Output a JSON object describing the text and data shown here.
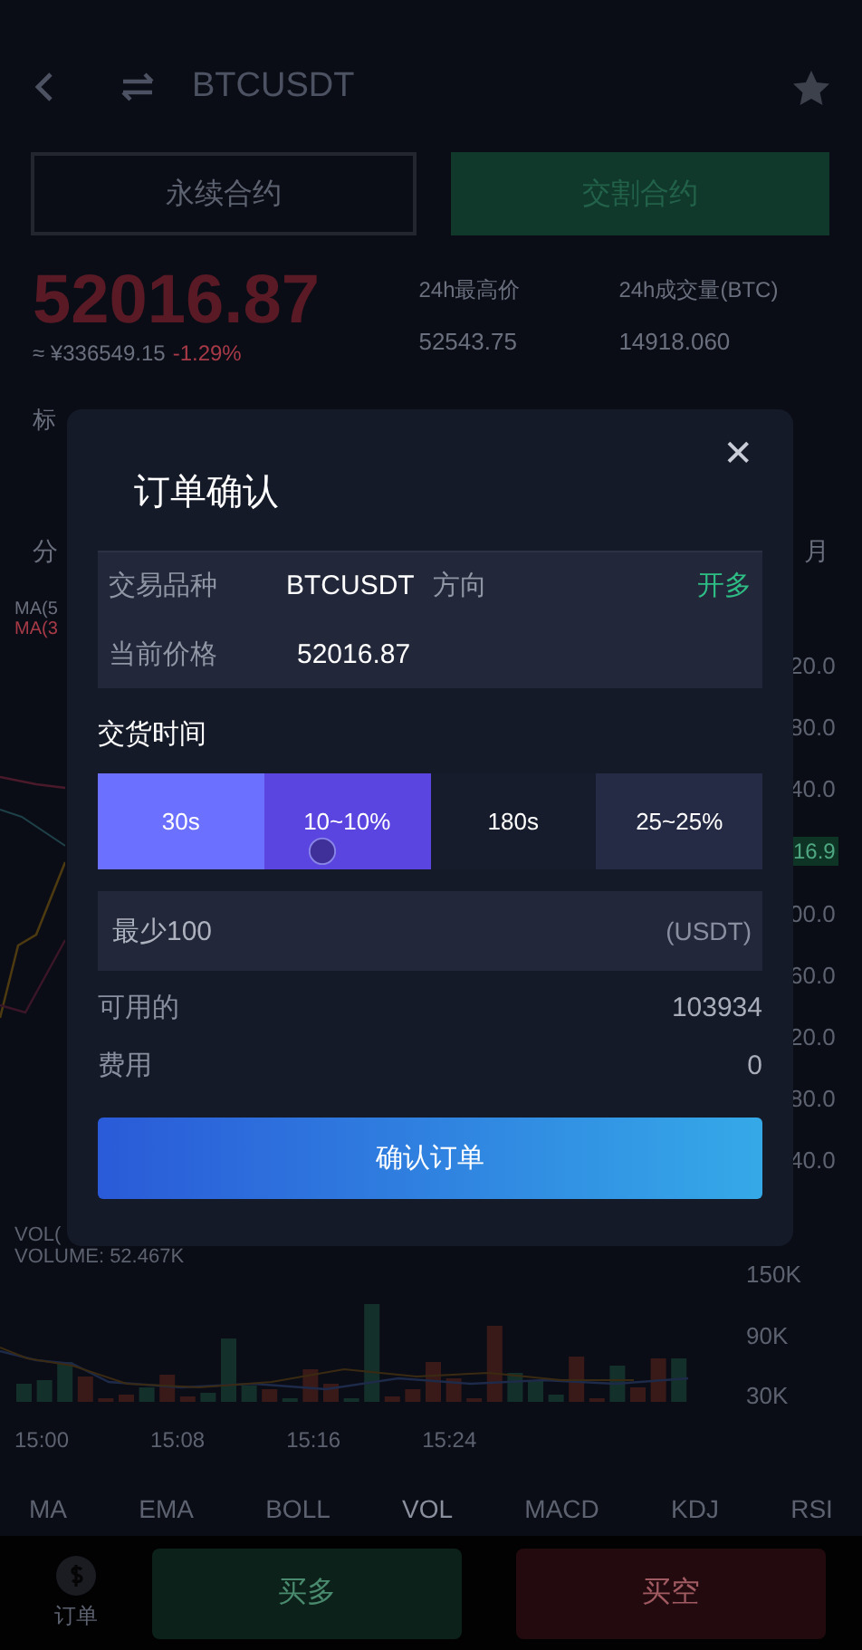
{
  "header": {
    "title": "BTCUSDT"
  },
  "contract_tabs": [
    {
      "label": "永续合约",
      "selected": false
    },
    {
      "label": "交割合约",
      "selected": true
    }
  ],
  "ticker": {
    "price": "52016.87",
    "cny": "≈ ¥336549.15",
    "change": "-1.29%",
    "stats": [
      {
        "label": "24h最高价",
        "value": "52543.75"
      },
      {
        "label": "24h成交量(BTC)",
        "value": "14918.060"
      }
    ]
  },
  "mark_label": "标",
  "timeframes": [
    "分",
    "月"
  ],
  "price_chart": {
    "legend": [
      "MA(5",
      "MA(3"
    ],
    "y_labels": [
      "20.0",
      "80.0",
      "40.0",
      "00.0",
      "60.0",
      "20.0",
      "80.0",
      "40.0"
    ],
    "last_price": "16.9"
  },
  "volume_chart": {
    "legend": [
      "VOL(",
      "VOLUME: 52.467K"
    ],
    "y_labels": [
      "150K",
      "90K",
      "30K"
    ],
    "times": [
      "15:00",
      "15:08",
      "15:16",
      "15:24"
    ]
  },
  "indicators": [
    {
      "label": "MA",
      "selected": false
    },
    {
      "label": "EMA",
      "selected": false
    },
    {
      "label": "BOLL",
      "selected": false
    },
    {
      "label": "VOL",
      "selected": true
    },
    {
      "label": "MACD",
      "selected": false
    },
    {
      "label": "KDJ",
      "selected": false
    },
    {
      "label": "RSI",
      "selected": false
    }
  ],
  "bottom_bar": {
    "orders_label": "订单",
    "buy": "买多",
    "sell": "买空"
  },
  "modal": {
    "title": "订单确认",
    "close": "✕",
    "info": [
      {
        "label": "交易品种",
        "value": "BTCUSDT",
        "extra_label": "方向",
        "extra_value": "开多"
      },
      {
        "label": "当前价格",
        "value": "52016.87"
      }
    ],
    "section_title": "交货时间",
    "options": [
      {
        "label": "30s",
        "kind": "time",
        "selected": true
      },
      {
        "label": "10~10%",
        "kind": "rate",
        "selected": true
      },
      {
        "label": "180s",
        "kind": "time",
        "selected": false
      },
      {
        "label": "25~25%",
        "kind": "rate",
        "selected": false
      }
    ],
    "amount": {
      "placeholder": "最少100",
      "unit": "(USDT)"
    },
    "summary": [
      {
        "label": "可用的",
        "value": "103934"
      },
      {
        "label": "费用",
        "value": "0"
      }
    ],
    "confirm": "确认订单"
  }
}
